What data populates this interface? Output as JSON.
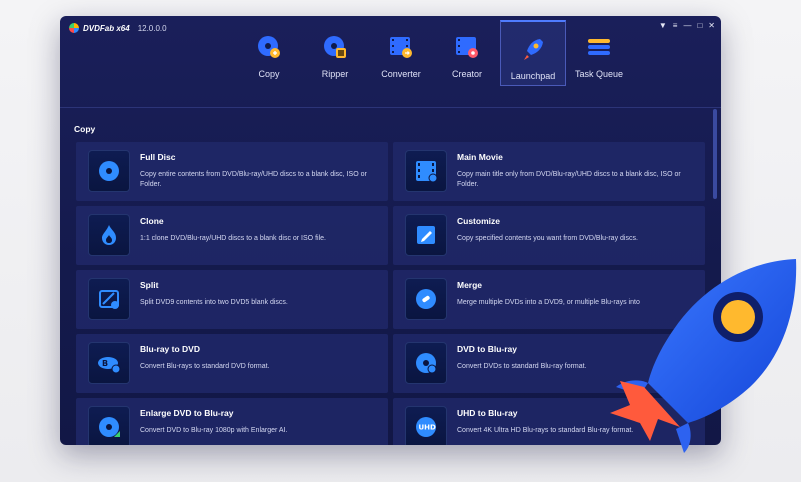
{
  "app": {
    "brand": "DVDFab x64",
    "version": "12.0.0.0"
  },
  "window_controls": [
    "▼",
    "≡",
    "—",
    "□",
    "✕"
  ],
  "nav": [
    {
      "label": "Copy",
      "icon": "disc-copy-icon"
    },
    {
      "label": "Ripper",
      "icon": "disc-ripper-icon"
    },
    {
      "label": "Converter",
      "icon": "film-converter-icon"
    },
    {
      "label": "Creator",
      "icon": "film-creator-icon"
    },
    {
      "label": "Launchpad",
      "icon": "rocket-icon",
      "active": true
    },
    {
      "label": "Task Queue",
      "icon": "task-queue-icon"
    }
  ],
  "section": {
    "title": "Copy"
  },
  "cards": [
    {
      "title": "Full Disc",
      "desc": "Copy entire contents from DVD/Blu-ray/UHD discs to a blank disc, ISO or Folder.",
      "icon": "disc-icon"
    },
    {
      "title": "Main Movie",
      "desc": "Copy main title only from DVD/Blu-ray/UHD discs to a blank disc, ISO or Folder.",
      "icon": "film-icon"
    },
    {
      "title": "Clone",
      "desc": "1:1 clone DVD/Blu-ray/UHD discs to a blank disc or ISO file.",
      "icon": "flame-icon"
    },
    {
      "title": "Customize",
      "desc": "Copy specified contents you want from DVD/Blu-ray discs.",
      "icon": "edit-icon"
    },
    {
      "title": "Split",
      "desc": "Split DVD9 contents into two DVD5 blank discs.",
      "icon": "split-icon"
    },
    {
      "title": "Merge",
      "desc": "Merge multiple DVDs into a DVD9, or multiple Blu-rays into",
      "icon": "merge-icon"
    },
    {
      "title": "Blu-ray to DVD",
      "desc": "Convert Blu-rays to standard DVD format.",
      "icon": "bluray-icon"
    },
    {
      "title": "DVD to Blu-ray",
      "desc": "Convert DVDs to standard Blu-ray format.",
      "icon": "dvd-disc-icon"
    },
    {
      "title": "Enlarge DVD to Blu-ray",
      "desc": "Convert DVD to Blu-ray 1080p with Enlarger AI.",
      "icon": "enlarge-disc-icon"
    },
    {
      "title": "UHD to Blu-ray",
      "desc": "Convert 4K Ultra HD Blu-rays to standard Blu-ray format.",
      "icon": "uhd-icon"
    }
  ],
  "colors": {
    "accent": "#4f7cff",
    "rocket_body": "#1d57e6",
    "rocket_flame": "#ff5a3c",
    "rocket_window": "#ffb92e"
  }
}
